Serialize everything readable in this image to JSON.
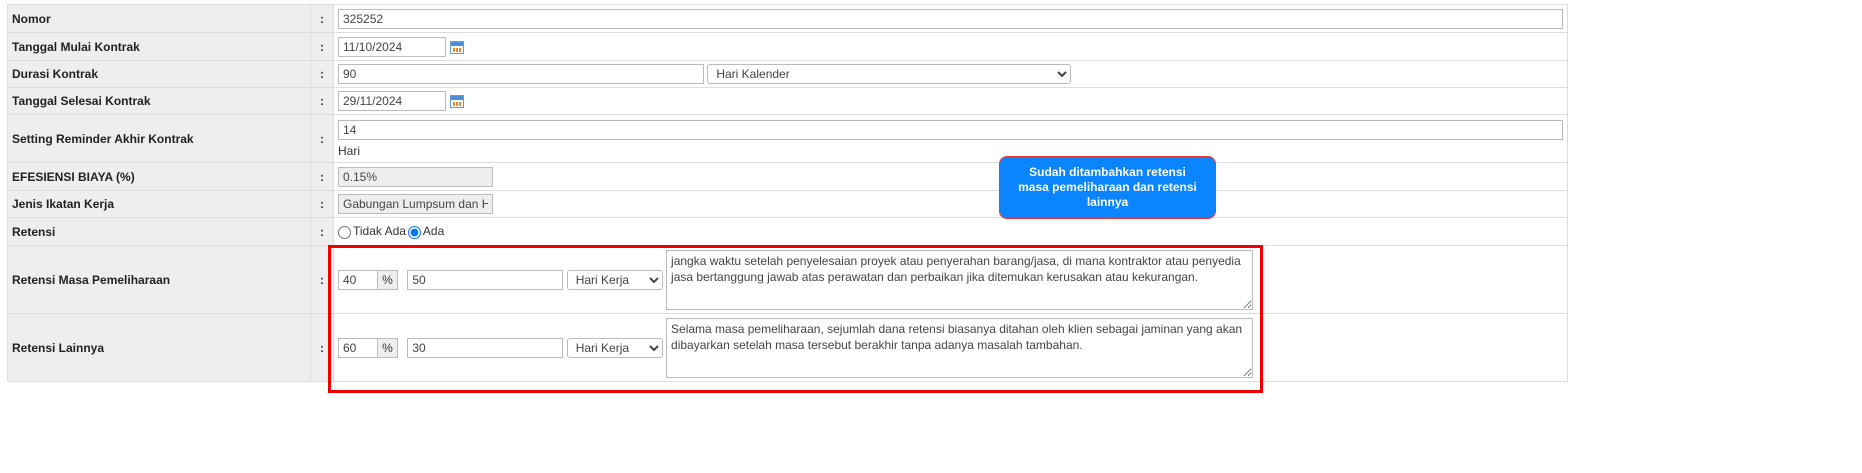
{
  "rows": {
    "nomor": {
      "label": "Nomor",
      "value": "325252"
    },
    "mulai": {
      "label": "Tanggal Mulai Kontrak",
      "value": "11/10/2024"
    },
    "durasi": {
      "label": "Durasi Kontrak",
      "value": "90",
      "unit": "Hari Kalender"
    },
    "selesai": {
      "label": "Tanggal Selesai Kontrak",
      "value": "29/11/2024"
    },
    "reminder": {
      "label": "Setting Reminder Akhir Kontrak",
      "value": "14",
      "suffix": "Hari"
    },
    "efesiensi": {
      "label": "EFESIENSI BIAYA (%)",
      "value": "0.15%"
    },
    "jenis": {
      "label": "Jenis Ikatan Kerja",
      "value": "Gabungan Lumpsum dan H"
    },
    "retensi": {
      "label": "Retensi",
      "opt_no": "Tidak Ada",
      "opt_yes": "Ada"
    },
    "pemeliharaan": {
      "label": "Retensi Masa Pemeliharaan",
      "percent": "40",
      "pct_sign": "%",
      "days": "50",
      "unit": "Hari Kerja",
      "note": "jangka waktu setelah penyelesaian proyek atau penyerahan barang/jasa, di mana kontraktor atau penyedia jasa bertanggung jawab atas perawatan dan perbaikan jika ditemukan kerusakan atau kekurangan."
    },
    "lainnya": {
      "label": "Retensi Lainnya",
      "percent": "60",
      "pct_sign": "%",
      "days": "30",
      "unit": "Hari Kerja",
      "note": "Selama masa pemeliharaan, sejumlah dana retensi biasanya ditahan oleh klien sebagai jaminan yang akan dibayarkan setelah masa tersebut berakhir tanpa adanya masalah tambahan."
    }
  },
  "colon": ":",
  "callout": "Sudah ditambahkan retensi masa pemeliharaan dan retensi lainnya"
}
